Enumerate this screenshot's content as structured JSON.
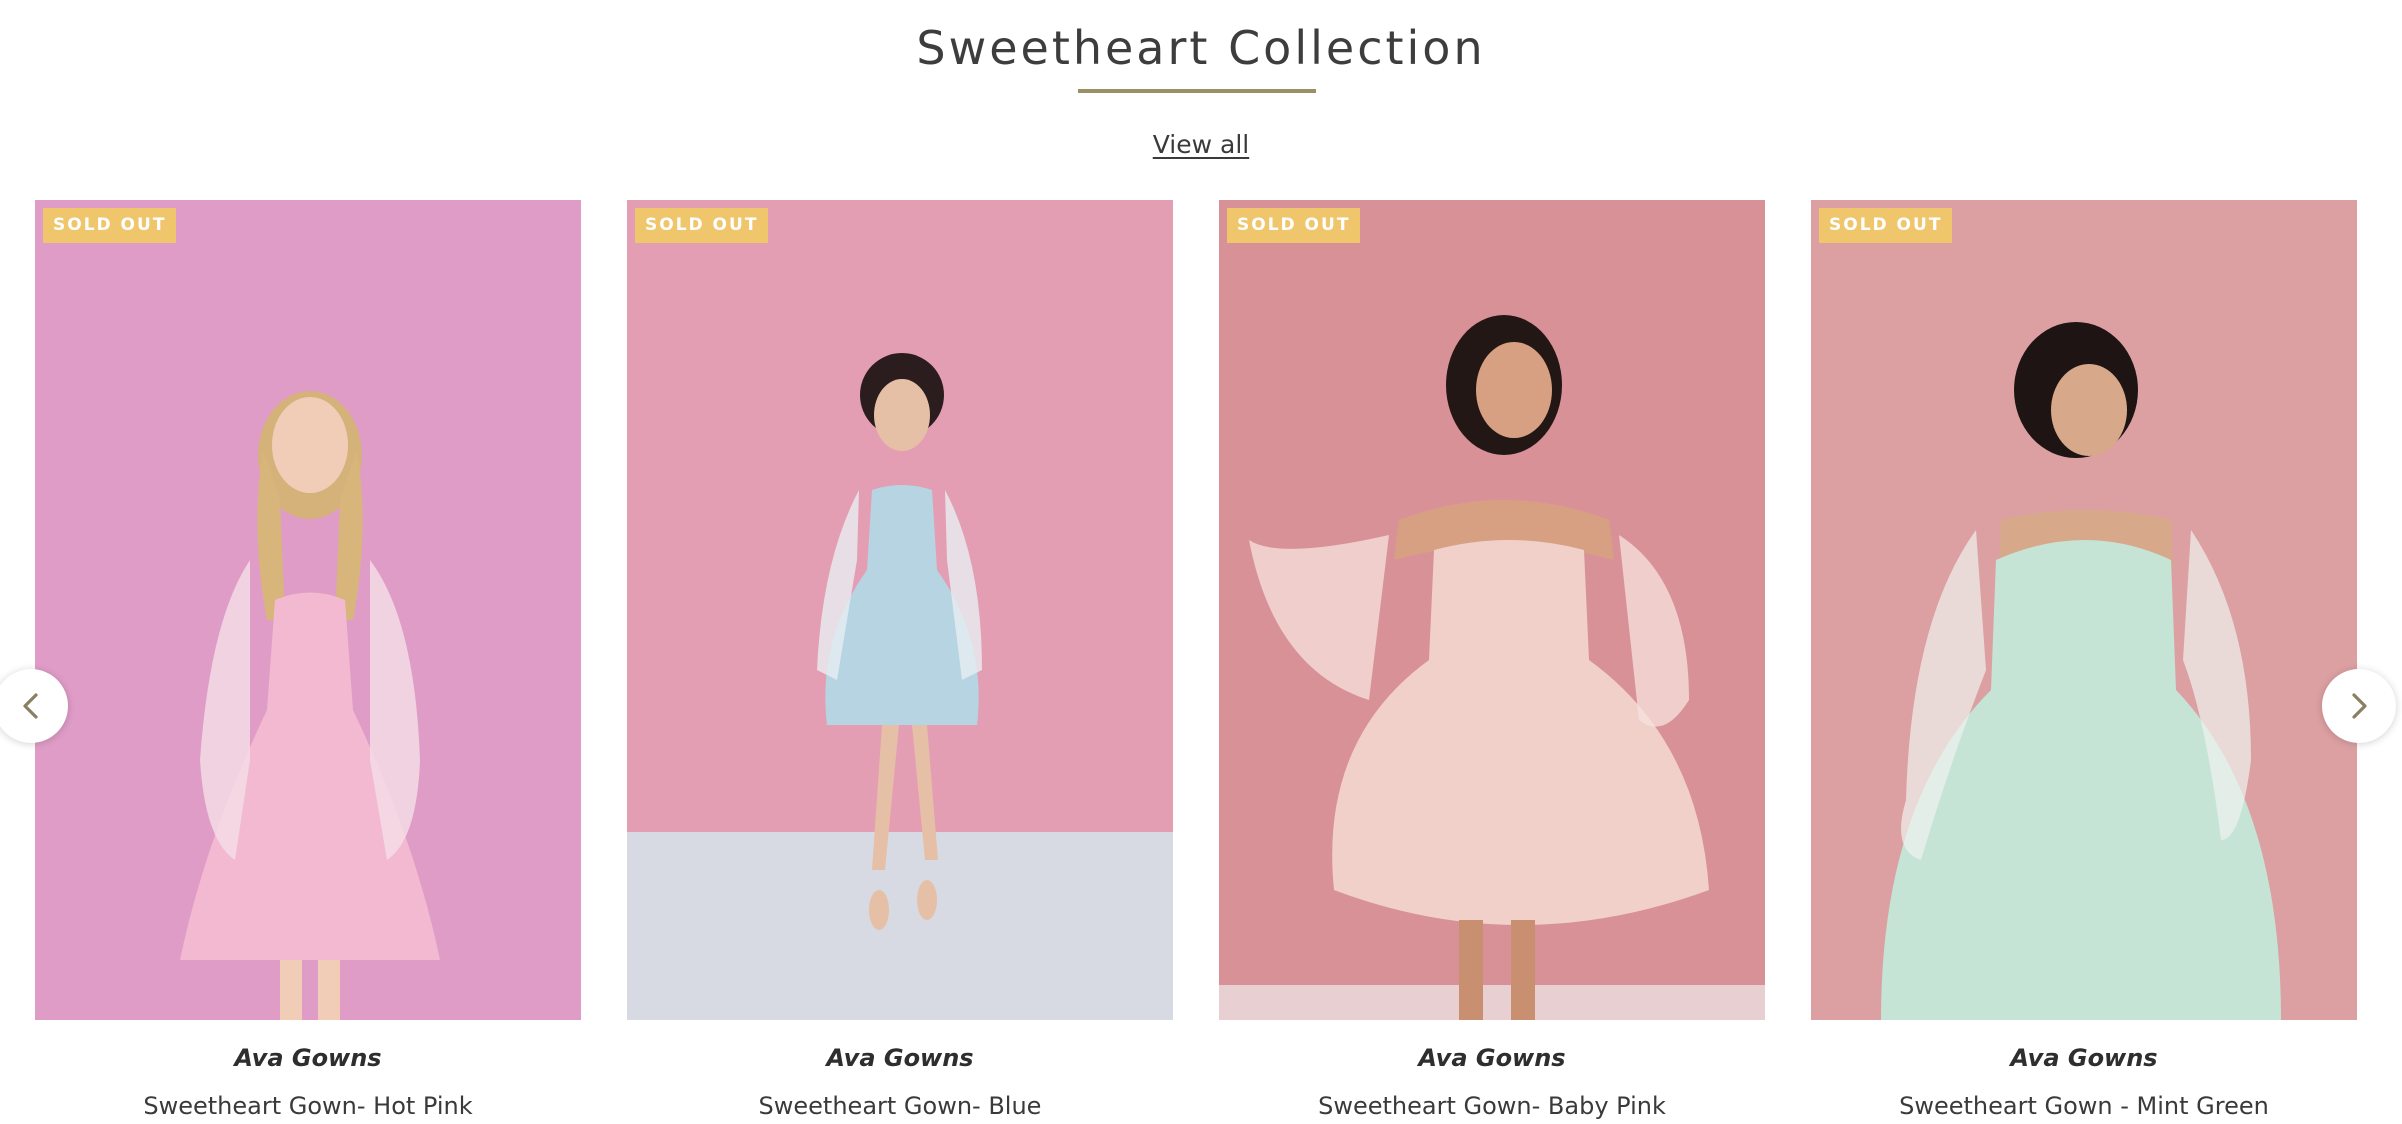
{
  "section": {
    "title": "Sweetheart Collection",
    "view_all": "View all",
    "accent_color": "#9b8f68",
    "badge_color": "#f0c66d"
  },
  "carousel": {
    "prev_icon": "chevron-left-icon",
    "next_icon": "chevron-right-icon"
  },
  "products": [
    {
      "badge": "SOLD OUT",
      "vendor": "Ava Gowns",
      "name": "Sweetheart Gown- Hot Pink",
      "bg": "#df9cc7",
      "floor": "#df9cc7",
      "dress": "#f3b9d0"
    },
    {
      "badge": "SOLD OUT",
      "vendor": "Ava Gowns",
      "name": "Sweetheart Gown- Blue",
      "bg": "#e49eb3",
      "floor": "#d7dae3",
      "dress": "#b7d4e2"
    },
    {
      "badge": "SOLD OUT",
      "vendor": "Ava Gowns",
      "name": "Sweetheart Gown- Baby Pink",
      "bg": "#d99198",
      "floor": "#e8cfd2",
      "dress": "#f1d0c9"
    },
    {
      "badge": "SOLD OUT",
      "vendor": "Ava Gowns",
      "name": "Sweetheart Gown - Mint Green",
      "bg": "#dca0a2",
      "floor": "#e6c9c9",
      "dress": "#c5e4d6"
    }
  ]
}
